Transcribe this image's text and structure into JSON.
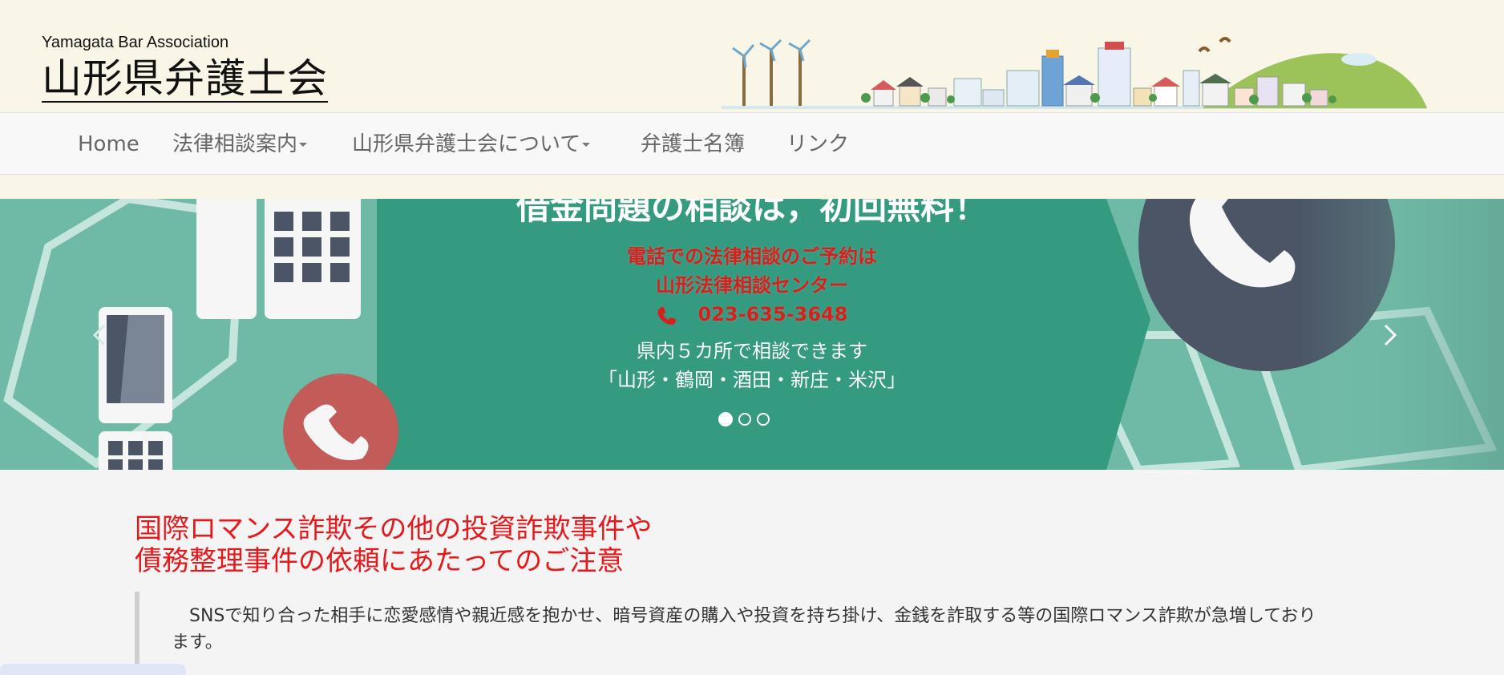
{
  "header": {
    "brand_en": "Yamagata Bar Association",
    "brand_ja": "山形県弁護士会"
  },
  "nav": {
    "items": [
      {
        "label": "Home",
        "dropdown": false
      },
      {
        "label": "法律相談案内",
        "dropdown": true
      },
      {
        "label": "山形県弁護士会について",
        "dropdown": true
      },
      {
        "label": "弁護士名簿",
        "dropdown": false
      },
      {
        "label": "リンク",
        "dropdown": false
      }
    ]
  },
  "carousel": {
    "title": "借金問題の相談は，初回無料！",
    "reservation_line1": "電話での法律相談のご予約は",
    "reservation_line2": "山形法律相談センター",
    "phone_number": "023-635-3648",
    "locations_line1": "県内５カ所で相談できます",
    "locations_line2": "「山形・鶴岡・酒田・新庄・米沢」",
    "slide_count": 3,
    "active_slide": 1,
    "colors": {
      "panel": "#349a80",
      "accent_red": "#d7201b",
      "phone_circle": "#4b5566"
    }
  },
  "notice": {
    "title_line1": "国際ロマンス詐欺その他の投資詐欺事件や",
    "title_line2": "債務整理事件の依頼にあたってのご注意",
    "body": "　SNSで知り合った相手に恋愛感情や親近感を抱かせ、暗号資産の購入や投資を持ち掛け、金銭を詐取する等の国際ロマンス詐欺が急増しております。",
    "title_color": "#e5181b"
  }
}
